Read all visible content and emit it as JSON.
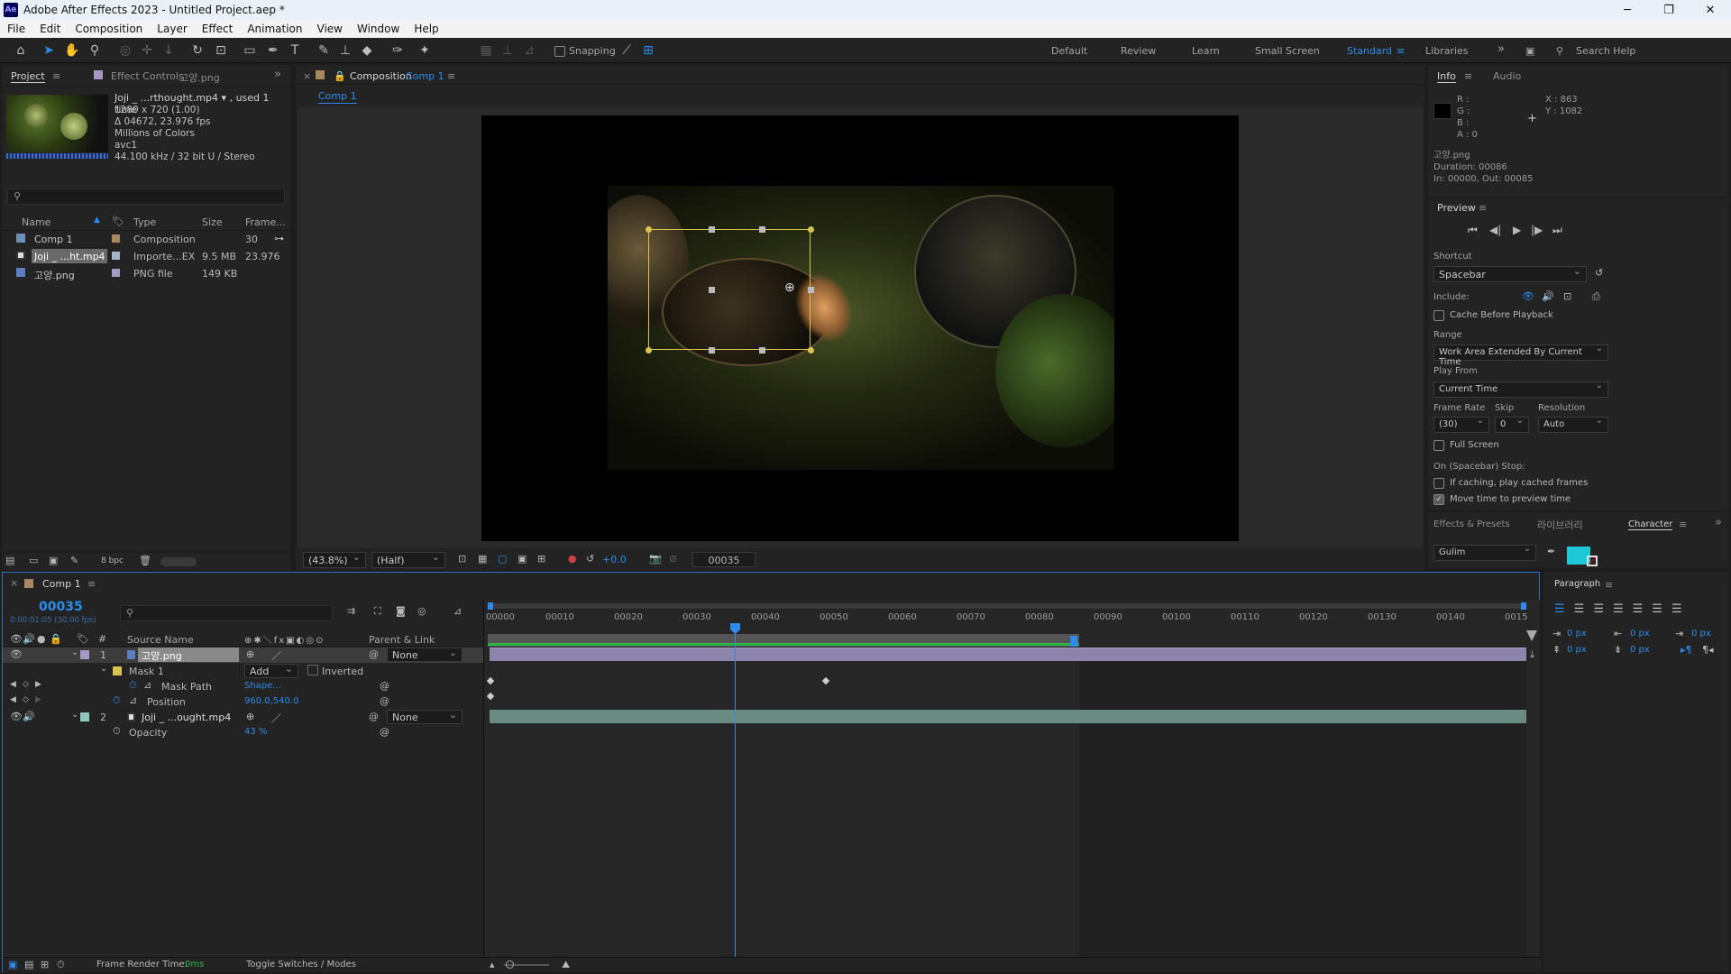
{
  "app": {
    "title": "Adobe After Effects 2023 - Untitled Project.aep *",
    "logo": "Ae",
    "menu": [
      "File",
      "Edit",
      "Composition",
      "Layer",
      "Effect",
      "Animation",
      "View",
      "Window",
      "Help"
    ]
  },
  "toolbar": {
    "snapping_label": "Snapping",
    "workspaces": [
      "Default",
      "Review",
      "Learn",
      "Small Screen",
      "Standard",
      "Libraries"
    ],
    "active_workspace": "Standard",
    "search_placeholder": "Search Help"
  },
  "project_panel": {
    "tab_project": "Project",
    "tab_effect_controls": "Effect Controls",
    "effect_controls_target": "고양.png",
    "footage_name": "Joji _ ...rthought.mp4",
    "footage_used": ", used 1 time",
    "footage_info": [
      "1280 x 720 (1.00)",
      "Δ 04672, 23.976 fps",
      "Millions of Colors",
      "avc1",
      "44.100 kHz / 32 bit U / Stereo"
    ],
    "search_placeholder": "",
    "columns": [
      "Name",
      "Type",
      "Size",
      "Frame..."
    ],
    "items": [
      {
        "name": "Comp 1",
        "type": "Composition",
        "size": "",
        "frame": "30",
        "label_color": "#a8865e"
      },
      {
        "name": "Joji _ ...ht.mp4",
        "type": "Importe...EX",
        "size": "9.5 MB",
        "frame": "23.976",
        "label_color": "#a7b3c9"
      },
      {
        "name": "고양.png",
        "type": "PNG file",
        "size": "149 KB",
        "frame": "",
        "label_color": "#a59ac6"
      }
    ],
    "bpc": "8 bpc"
  },
  "comp_panel": {
    "tab_label": "Composition",
    "comp_name": "Comp 1",
    "subtab": "Comp 1",
    "zoom": "(43.8%)",
    "resolution": "(Half)",
    "exposure": "+0.0",
    "timecode": "00035"
  },
  "info_panel": {
    "tab_info": "Info",
    "tab_audio": "Audio",
    "r": "R :",
    "g": "G :",
    "b": "B :",
    "a": "A : 0",
    "x": "X : 863",
    "y": "Y : 1082",
    "layer_name": "고양.png",
    "duration": "Duration: 00086",
    "in_out": "In: 00000, Out: 00085"
  },
  "preview_panel": {
    "title": "Preview",
    "shortcut_label": "Shortcut",
    "shortcut_value": "Spacebar",
    "include_label": "Include:",
    "cache_label": "Cache Before Playback",
    "range_label": "Range",
    "range_value": "Work Area Extended By Current Time",
    "play_from_label": "Play From",
    "play_from_value": "Current Time",
    "frame_rate_label": "Frame Rate",
    "frame_rate_value": "(30)",
    "skip_label": "Skip",
    "skip_value": "0",
    "resolution_label": "Resolution",
    "resolution_value": "Auto",
    "full_screen_label": "Full Screen",
    "stop_label": "On (Spacebar) Stop:",
    "if_caching_label": "If caching, play cached frames",
    "move_time_label": "Move time to preview time",
    "move_time_checked": true
  },
  "character_panel": {
    "tab_effects": "Effects & Presets",
    "tab_library": "라이브러리",
    "tab_character": "Character",
    "font": "Gulim",
    "fill_color": "#1fc7d6"
  },
  "paragraph_panel": {
    "title": "Paragraph",
    "indent_values": [
      "0 px",
      "0 px",
      "0 px",
      "0 px",
      "0 px"
    ]
  },
  "timeline": {
    "tab_label": "Comp 1",
    "timecode": "00035",
    "timecode_sub": "0:00:01:05 (30.00 fps)",
    "col_source": "Source Name",
    "col_parent": "Parent & Link",
    "ruler": [
      "00000",
      "00010",
      "00020",
      "00030",
      "00040",
      "00050",
      "00060",
      "00070",
      "00080",
      "00090",
      "00100",
      "00110",
      "00120",
      "00130",
      "00140",
      "0015"
    ],
    "layers": [
      {
        "num": "1",
        "name": "고양.png",
        "parent": "None",
        "label_color": "#a59ac6"
      },
      {
        "num": "2",
        "name": "Joji _ ...ought.mp4",
        "parent": "None",
        "label_color": "#8fc8c0"
      }
    ],
    "mask_name": "Mask 1",
    "mask_mode": "Add",
    "mask_inverted": "Inverted",
    "mask_path_label": "Mask Path",
    "mask_path_value": "Shape...",
    "position_label": "Position",
    "position_value": "960.0,540.0",
    "opacity_label": "Opacity",
    "opacity_value": "43 %",
    "footer_render_label": "Frame Render Time:",
    "footer_render_value": "0ms",
    "footer_toggle": "Toggle Switches / Modes"
  }
}
